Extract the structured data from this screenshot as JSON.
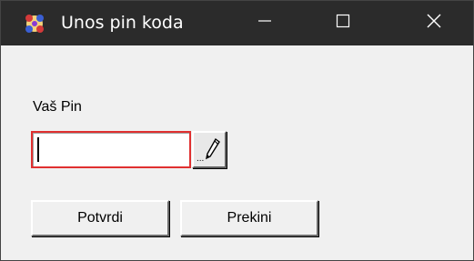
{
  "window": {
    "title": "Unos pin koda",
    "controls": {
      "minimize_icon": "minimize-icon",
      "maximize_icon": "maximize-icon",
      "close_icon": "close-icon"
    }
  },
  "form": {
    "pin_label": "Vaš Pin",
    "pin_value": "",
    "browse_dots": "...",
    "browse_icon": "pencil-icon"
  },
  "buttons": {
    "confirm_label": "Potvrdi",
    "cancel_label": "Prekini"
  },
  "colors": {
    "titlebar": "#2b2b2b",
    "input_border_focus": "#e03030",
    "window_bg": "#f0f0f0"
  }
}
